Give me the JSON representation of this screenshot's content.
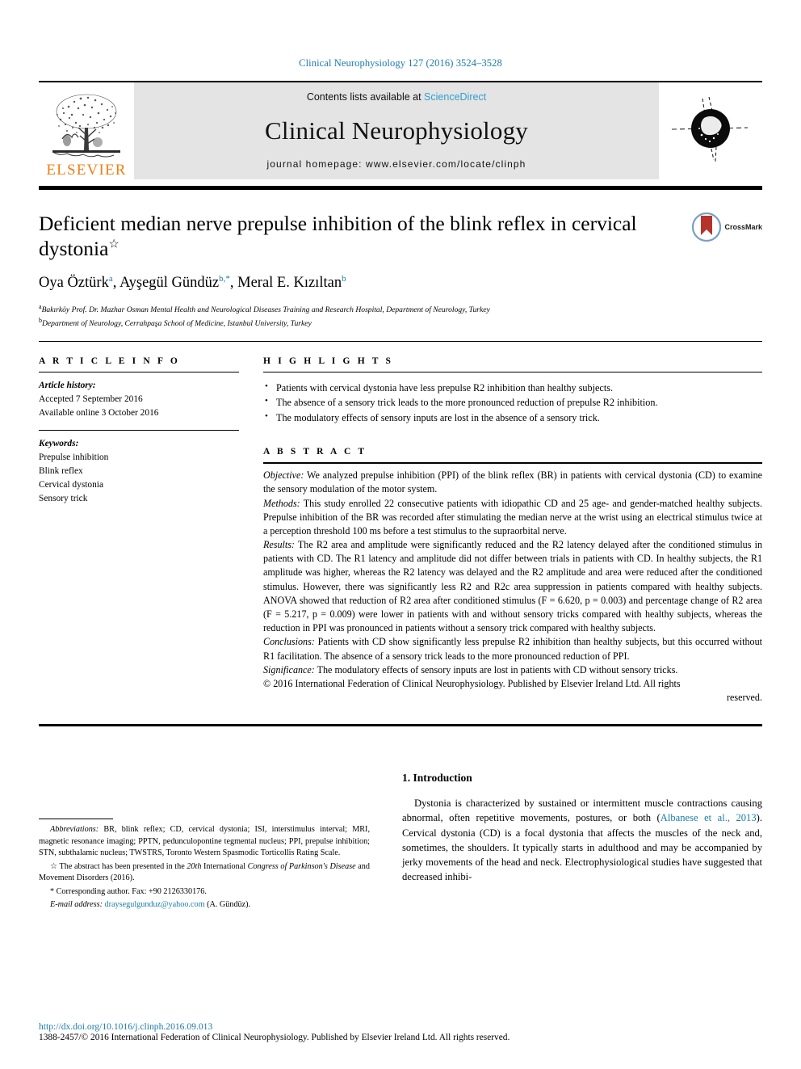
{
  "running_head": "Clinical Neurophysiology 127 (2016) 3524–3528",
  "masthead": {
    "contents_prefix": "Contents lists available at ",
    "sciencedirect": "ScienceDirect",
    "journal_title": "Clinical Neurophysiology",
    "homepage": "journal homepage: www.elsevier.com/locate/clinph",
    "publisher": "ELSEVIER",
    "sciencedirect_color": "#2f9fd0",
    "elsevier_color": "#f07f13",
    "masthead_bg": "#e4e4e4"
  },
  "crossmark": {
    "label": "CrossMark"
  },
  "title": {
    "text": "Deficient median nerve prepulse inhibition of the blink reflex in cervical dystonia",
    "footnote_marker": "☆"
  },
  "authors": {
    "list": [
      {
        "name": "Oya Öztürk",
        "sup": "a"
      },
      {
        "name": "Ayşegül Gündüz",
        "sup": "b,*"
      },
      {
        "name": "Meral E. Kızıltan",
        "sup": "b"
      }
    ]
  },
  "affiliations": [
    {
      "marker": "a",
      "text": "Bakırköy Prof. Dr. Mazhar Osman Mental Health and Neurological Diseases Training and Research Hospital, Department of Neurology, Turkey"
    },
    {
      "marker": "b",
      "text": "Department of Neurology, Cerrahpaşa School of Medicine, Istanbul University, Turkey"
    }
  ],
  "article_info": {
    "heading": "A R T I C L E    I N F O",
    "history_label": "Article history:",
    "history": [
      "Accepted 7 September 2016",
      "Available online 3 October 2016"
    ],
    "keywords_label": "Keywords:",
    "keywords": [
      "Prepulse inhibition",
      "Blink reflex",
      "Cervical dystonia",
      "Sensory trick"
    ]
  },
  "highlights": {
    "heading": "H I G H L I G H T S",
    "items": [
      "Patients with cervical dystonia have less prepulse R2 inhibition than healthy subjects.",
      "The absence of a sensory trick leads to the more pronounced reduction of prepulse R2 inhibition.",
      "The modulatory effects of sensory inputs are lost in the absence of a sensory trick."
    ]
  },
  "abstract": {
    "heading": "A B S T R A C T",
    "sections": [
      {
        "label": "Objective:",
        "text": " We analyzed prepulse inhibition (PPI) of the blink reflex (BR) in patients with cervical dystonia (CD) to examine the sensory modulation of the motor system."
      },
      {
        "label": "Methods:",
        "text": " This study enrolled 22 consecutive patients with idiopathic CD and 25 age- and gender-matched healthy subjects. Prepulse inhibition of the BR was recorded after stimulating the median nerve at the wrist using an electrical stimulus twice at a perception threshold 100 ms before a test stimulus to the supraorbital nerve."
      },
      {
        "label": "Results:",
        "text": " The R2 area and amplitude were significantly reduced and the R2 latency delayed after the conditioned stimulus in patients with CD. The R1 latency and amplitude did not differ between trials in patients with CD. In healthy subjects, the R1 amplitude was higher, whereas the R2 latency was delayed and the R2 amplitude and area were reduced after the conditioned stimulus. However, there was significantly less R2 and R2c area suppression in patients compared with healthy subjects. ANOVA showed that reduction of R2 area after conditioned stimulus (F = 6.620, p = 0.003) and percentage change of R2 area (F = 5.217, p = 0.009) were lower in patients with and without sensory tricks compared with healthy subjects, whereas the reduction in PPI was pronounced in patients without a sensory trick compared with healthy subjects."
      },
      {
        "label": "Conclusions:",
        "text": " Patients with CD show significantly less prepulse R2 inhibition than healthy subjects, but this occurred without R1 facilitation. The absence of a sensory trick leads to the more pronounced reduction of PPI."
      },
      {
        "label": "Significance:",
        "text": " The modulatory effects of sensory inputs are lost in patients with CD without sensory tricks."
      }
    ],
    "copyright": "© 2016 International Federation of Clinical Neurophysiology. Published by Elsevier Ireland Ltd. All rights",
    "copyright_tail": "reserved."
  },
  "footnotes": {
    "abbreviations_label": "Abbreviations:",
    "abbreviations_text": " BR, blink reflex; CD, cervical dystonia; ISI, interstimulus interval; MRI, magnetic resonance imaging; PPTN, pedunculopontine tegmental nucleus; PPI, prepulse inhibition; STN, subthalamic nucleus; TWSTRS, Toronto Western Spasmodic Torticollis Rating Scale.",
    "star_note_pre": "☆ The abstract has been presented in the ",
    "star_note_ital1": "20th",
    "star_note_mid": " International ",
    "star_note_ital2": "Congress of Parkinson's Disease",
    "star_note_post": " and Movement Disorders (2016).",
    "corresponding": "* Corresponding author. Fax: +90 2126330176.",
    "email_label": "E-mail address:",
    "email": "draysegulgunduz@yahoo.com",
    "email_owner": " (A. Gündüz)."
  },
  "introduction": {
    "heading": "1. Introduction",
    "paragraph_pre": "Dystonia is characterized by sustained or intermittent muscle contractions causing abnormal, often repetitive movements, postures, or both (",
    "citation": "Albanese et al., 2013",
    "paragraph_post": "). Cervical dystonia (CD) is a focal dystonia that affects the muscles of the neck and, sometimes, the shoulders. It typically starts in adulthood and may be accompanied by jerky movements of the head and neck. Electrophysiological studies have suggested that decreased inhibi-"
  },
  "page_footer": {
    "doi": "http://dx.doi.org/10.1016/j.clinph.2016.09.013",
    "issn_line": "1388-2457/© 2016 International Federation of Clinical Neurophysiology. Published by Elsevier Ireland Ltd. All rights reserved."
  },
  "colors": {
    "link_blue": "#1a7ba8",
    "accent_orange": "#f07f13",
    "crossmark_red": "#b5332a"
  }
}
